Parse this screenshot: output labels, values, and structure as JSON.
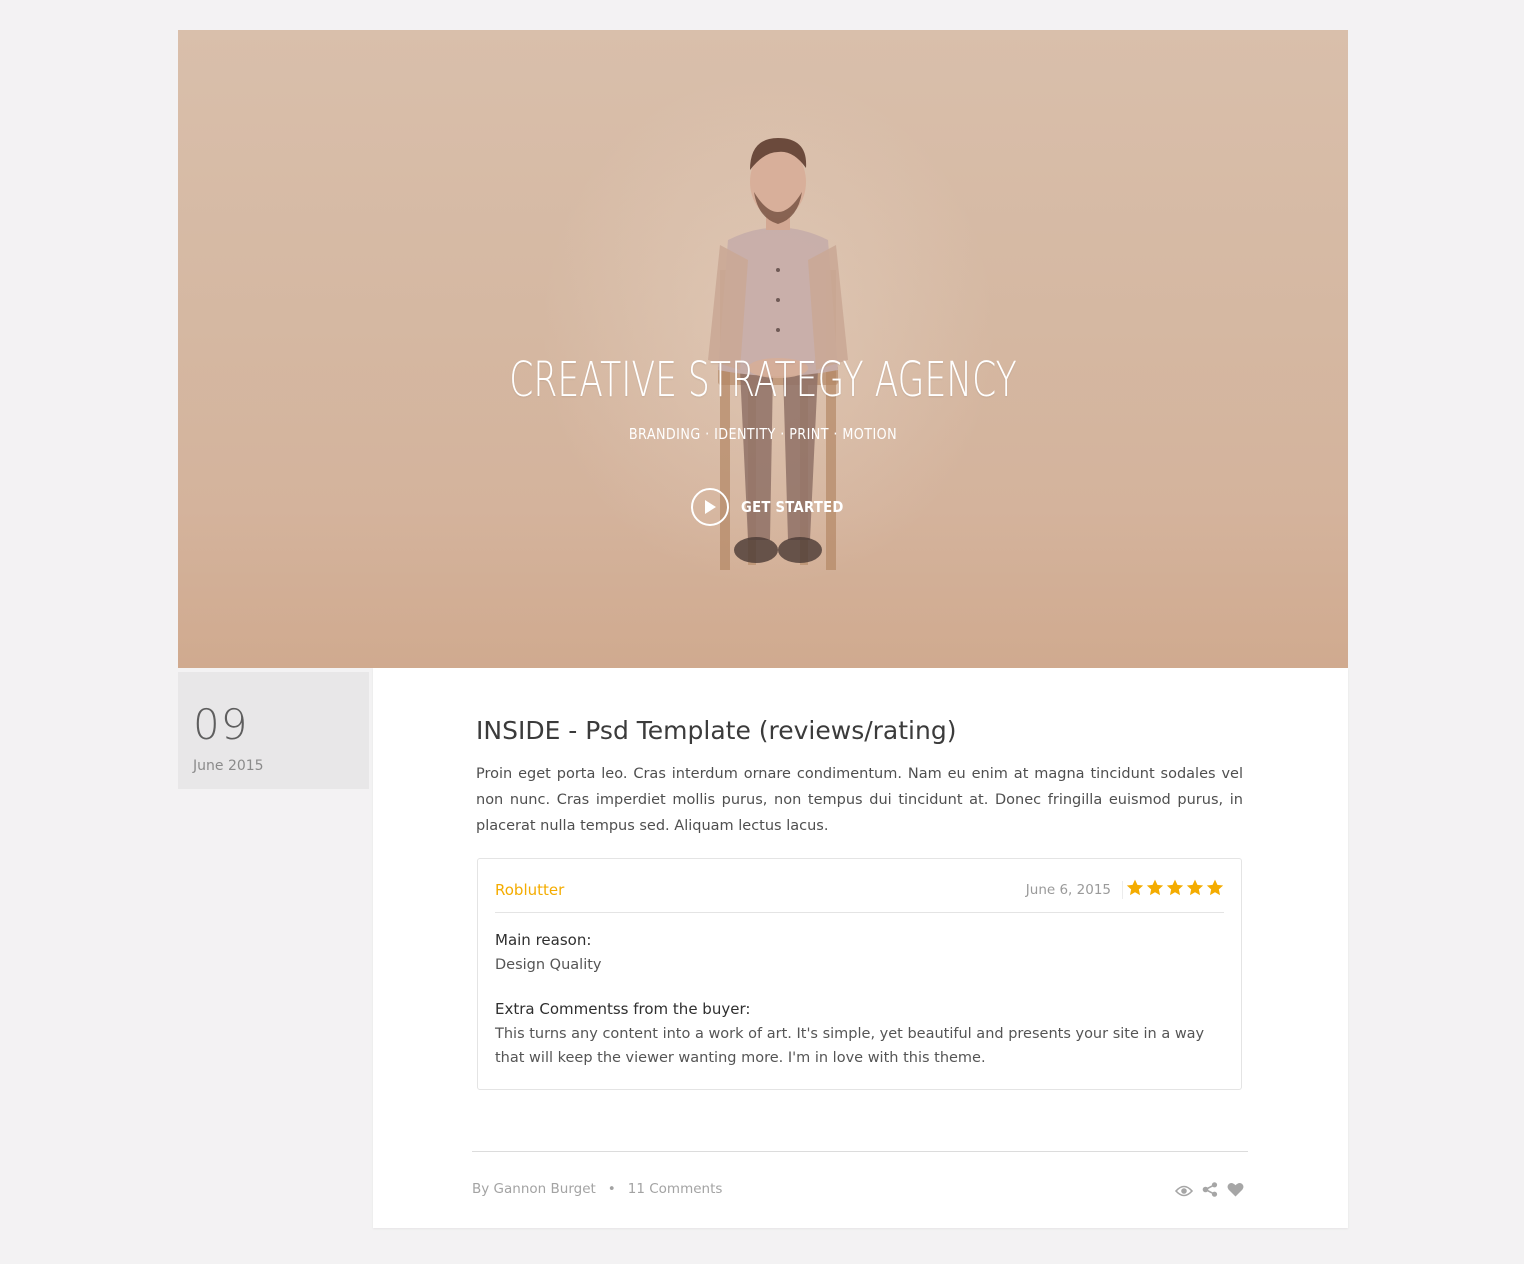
{
  "hero": {
    "title": "CREATIVE STRATEGY AGENCY",
    "subtitle": "BRANDING · IDENTITY · PRINT · MOTION",
    "cta_label": "GET STARTED"
  },
  "date": {
    "day": "09",
    "month_year": "June 2015"
  },
  "post": {
    "title": "INSIDE - Psd Template (reviews/rating)",
    "excerpt": "Proin eget porta leo. Cras interdum ornare condimentum. Nam eu enim at magna tincidunt sodales vel non nunc. Cras imperdiet mollis purus, non tempus dui tincidunt at. Donec fringilla euismod purus, in placerat nulla tempus sed. Aliquam lectus lacus."
  },
  "review": {
    "author": "Roblutter",
    "date": "June 6, 2015",
    "rating": 5,
    "rating_max": 5,
    "star_color": "#f4ac00",
    "main_reason_label": "Main reason:",
    "main_reason_value": "Design Quality",
    "comments_label": "Extra Commentss from the buyer:",
    "comments_value": "This turns any content into a work of art. It's simple, yet beautiful and presents your site in a way that will keep the viewer wanting more. I'm in love with this theme."
  },
  "meta": {
    "author": "By Gannon Burget",
    "separator": "•",
    "comments": "11 Comments"
  },
  "icons": [
    "play-icon",
    "eye-icon",
    "share-icon",
    "heart-icon",
    "star-icon"
  ]
}
